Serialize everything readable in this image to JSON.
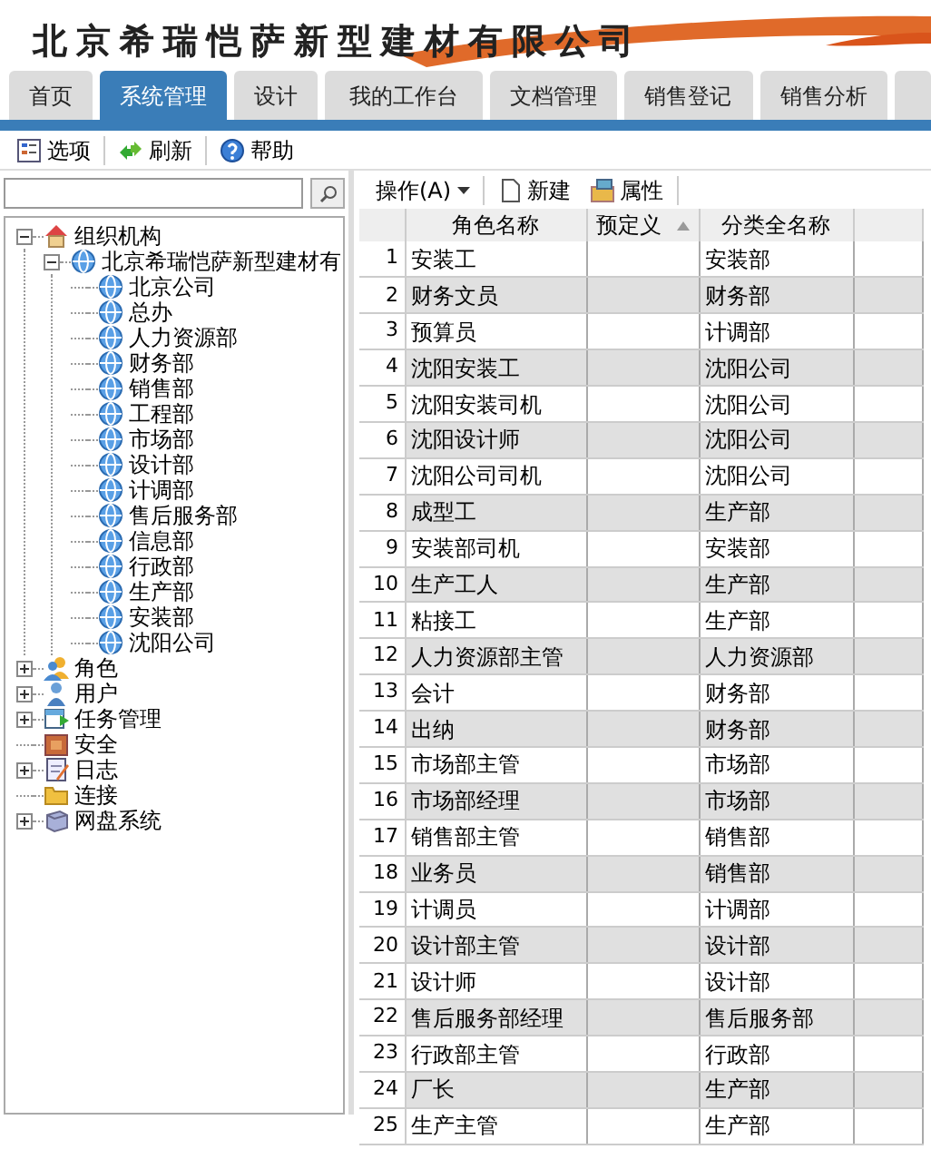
{
  "header": {
    "title": "北京希瑞恺萨新型建材有限公司"
  },
  "tabs": [
    {
      "label": "首页",
      "selected": false
    },
    {
      "label": "系统管理",
      "selected": true
    },
    {
      "label": "设计",
      "selected": false
    },
    {
      "label": "我的工作台",
      "selected": false
    },
    {
      "label": "文档管理",
      "selected": false
    },
    {
      "label": "销售登记",
      "selected": false
    },
    {
      "label": "销售分析",
      "selected": false
    },
    {
      "selected": false
    }
  ],
  "toolbar": [
    {
      "kind": "options",
      "label": "选项"
    },
    {
      "kind": "refresh",
      "label": "刷新"
    },
    {
      "kind": "help",
      "label": "帮助"
    }
  ],
  "tree": [
    {
      "label": "组织机构",
      "kind": "house",
      "expanded": true,
      "children": [
        {
          "label": "北京希瑞恺萨新型建材有",
          "kind": "globe",
          "expanded": true,
          "children": [
            {
              "label": "北京公司",
              "kind": "globe"
            },
            {
              "label": "总办",
              "kind": "globe"
            },
            {
              "label": "人力资源部",
              "kind": "globe"
            },
            {
              "label": "财务部",
              "kind": "globe"
            },
            {
              "label": "销售部",
              "kind": "globe"
            },
            {
              "label": "工程部",
              "kind": "globe"
            },
            {
              "label": "市场部",
              "kind": "globe"
            },
            {
              "label": "设计部",
              "kind": "globe"
            },
            {
              "label": "计调部",
              "kind": "globe"
            },
            {
              "label": "售后服务部",
              "kind": "globe"
            },
            {
              "label": "信息部",
              "kind": "globe"
            },
            {
              "label": "行政部",
              "kind": "globe"
            },
            {
              "label": "生产部",
              "kind": "globe"
            },
            {
              "label": "安装部",
              "kind": "globe"
            },
            {
              "label": "沈阳公司",
              "kind": "globe"
            }
          ]
        }
      ]
    },
    {
      "label": "角色",
      "kind": "people",
      "expanded": false
    },
    {
      "label": "用户",
      "kind": "user",
      "expanded": false
    },
    {
      "label": "任务管理",
      "kind": "task",
      "expanded": false
    },
    {
      "label": "安全",
      "kind": "safe"
    },
    {
      "label": "日志",
      "kind": "log",
      "expanded": false
    },
    {
      "label": "连接",
      "kind": "folder"
    },
    {
      "label": "网盘系统",
      "kind": "disk",
      "expanded": false
    }
  ],
  "grid_toolbar": [
    {
      "kind": "menu",
      "label": "操作(A)"
    },
    {
      "kind": "new",
      "label": "新建"
    },
    {
      "kind": "properties",
      "label": "属性"
    }
  ],
  "table": {
    "columns": [
      {
        "sorted": false
      },
      {
        "label": "角色名称",
        "sorted": false
      },
      {
        "label": "预定义",
        "sorted": true
      },
      {
        "label": "分类全名称",
        "sorted": false
      }
    ],
    "rows": [
      [
        "1",
        "安装工",
        "",
        "安装部"
      ],
      [
        "2",
        "财务文员",
        "",
        "财务部"
      ],
      [
        "3",
        "预算员",
        "",
        "计调部"
      ],
      [
        "4",
        "沈阳安装工",
        "",
        "沈阳公司"
      ],
      [
        "5",
        "沈阳安装司机",
        "",
        "沈阳公司"
      ],
      [
        "6",
        "沈阳设计师",
        "",
        "沈阳公司"
      ],
      [
        "7",
        "沈阳公司司机",
        "",
        "沈阳公司"
      ],
      [
        "8",
        "成型工",
        "",
        "生产部"
      ],
      [
        "9",
        "安装部司机",
        "",
        "安装部"
      ],
      [
        "10",
        "生产工人",
        "",
        "生产部"
      ],
      [
        "11",
        "粘接工",
        "",
        "生产部"
      ],
      [
        "12",
        "人力资源部主管",
        "",
        "人力资源部"
      ],
      [
        "13",
        "会计",
        "",
        "财务部"
      ],
      [
        "14",
        "出纳",
        "",
        "财务部"
      ],
      [
        "15",
        "市场部主管",
        "",
        "市场部"
      ],
      [
        "16",
        "市场部经理",
        "",
        "市场部"
      ],
      [
        "17",
        "销售部主管",
        "",
        "销售部"
      ],
      [
        "18",
        "业务员",
        "",
        "销售部"
      ],
      [
        "19",
        "计调员",
        "",
        "计调部"
      ],
      [
        "20",
        "设计部主管",
        "",
        "设计部"
      ],
      [
        "21",
        "设计师",
        "",
        "设计部"
      ],
      [
        "22",
        "售后服务部经理",
        "",
        "售后服务部"
      ],
      [
        "23",
        "行政部主管",
        "",
        "行政部"
      ],
      [
        "24",
        "厂长",
        "",
        "生产部"
      ],
      [
        "25",
        "生产主管",
        "",
        "生产部"
      ]
    ]
  }
}
